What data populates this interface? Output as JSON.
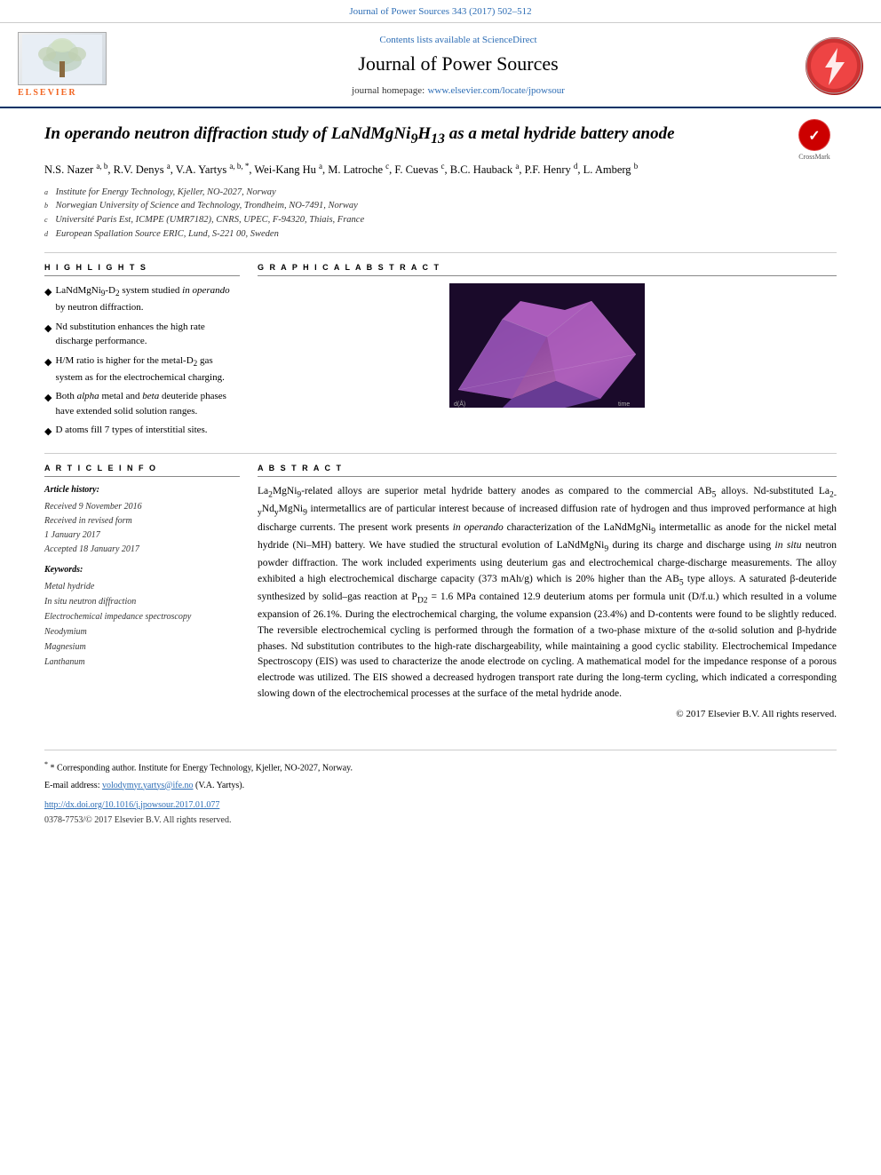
{
  "topBar": {
    "text": "Journal of Power Sources 343 (2017) 502–512"
  },
  "header": {
    "sciencedirect": "Contents lists available at ScienceDirect",
    "journalTitle": "Journal of Power Sources",
    "homepageLabel": "journal homepage:",
    "homepageUrl": "www.elsevier.com/locate/jpowsour",
    "elsevier": "ELSEVIER"
  },
  "article": {
    "titlePart1": "In operando",
    "titlePart2": " neutron diffraction study of LaNdMgNi",
    "titleSub1": "9",
    "titlePart3": "H",
    "titleSub2": "13",
    "titlePart4": " as a metal hydride battery anode",
    "authors": "N.S. Nazer a, b, R.V. Denys a, V.A. Yartys a, b, *, Wei-Kang Hu a, M. Latroche c, F. Cuevas c, B.C. Hauback a, P.F. Henry d, L. Amberg b",
    "affiliations": [
      {
        "sup": "a",
        "text": "Institute for Energy Technology, Kjeller, NO-2027, Norway"
      },
      {
        "sup": "b",
        "text": "Norwegian University of Science and Technology, Trondheim, NO-7491, Norway"
      },
      {
        "sup": "c",
        "text": "Université Paris Est, ICMPE (UMR7182), CNRS, UPEC, F-94320, Thiais, France"
      },
      {
        "sup": "d",
        "text": "European Spallation Source ERIC, Lund, S-221 00, Sweden"
      }
    ]
  },
  "highlights": {
    "sectionTitle": "H I G H L I G H T S",
    "items": [
      "LaNdMgNi9-D2 system studied in operando by neutron diffraction.",
      "Nd substitution enhances the high rate discharge performance.",
      "H/M ratio is higher for the metal-D2 gas system as for the electrochemical charging.",
      "Both alpha metal and beta deuteride phases have extended solid solution ranges.",
      "D atoms fill 7 types of interstitial sites."
    ]
  },
  "graphicalAbstract": {
    "sectionTitle": "G R A P H I C A L   A B S T R A C T"
  },
  "articleInfo": {
    "sectionTitle": "A R T I C L E   I N F O",
    "historyLabel": "Article history:",
    "received": "Received 9 November 2016",
    "receivedRevised": "Received in revised form",
    "revisedDate": "1 January 2017",
    "accepted": "Accepted 18 January 2017",
    "keywordsLabel": "Keywords:",
    "keywords": [
      "Metal hydride",
      "In situ neutron diffraction",
      "Electrochemical impedance spectroscopy",
      "Neodymium",
      "Magnesium",
      "Lanthanum"
    ]
  },
  "abstract": {
    "sectionTitle": "A B S T R A C T",
    "text": "La2MgNi9-related alloys are superior metal hydride battery anodes as compared to the commercial AB5 alloys. Nd-substituted La2-yNdyMgNi9 intermetallics are of particular interest because of increased diffusion rate of hydrogen and thus improved performance at high discharge currents. The present work presents in operando characterization of the LaNdMgNi9 intermetallic as anode for the nickel metal hydride (Ni–MH) battery. We have studied the structural evolution of LaNdMgNi9 during its charge and discharge using in situ neutron powder diffraction. The work included experiments using deuterium gas and electrochemical charge-discharge measurements. The alloy exhibited a high electrochemical discharge capacity (373 mAh/g) which is 20% higher than the AB5 type alloys. A saturated β-deuteride synthesized by solid–gas reaction at PD2 = 1.6 MPa contained 12.9 deuterium atoms per formula unit (D/f.u.) which resulted in a volume expansion of 26.1%. During the electrochemical charging, the volume expansion (23.4%) and D-contents were found to be slightly reduced. The reversible electrochemical cycling is performed through the formation of a two-phase mixture of the α-solid solution and β-hydride phases. Nd substitution contributes to the high-rate dischargeability, while maintaining a good cyclic stability. Electrochemical Impedance Spectroscopy (EIS) was used to characterize the anode electrode on cycling. A mathematical model for the impedance response of a porous electrode was utilized. The EIS showed a decreased hydrogen transport rate during the long-term cycling, which indicated a corresponding slowing down of the electrochemical processes at the surface of the metal hydride anode.",
    "copyright": "© 2017 Elsevier B.V. All rights reserved."
  },
  "footer": {
    "correspondingNote": "* Corresponding author. Institute for Energy Technology, Kjeller, NO-2027, Norway.",
    "emailLabel": "E-mail address:",
    "email": "volodymyr.yartys@ife.no",
    "emailSuffix": " (V.A. Yartys).",
    "doi": "http://dx.doi.org/10.1016/j.jpowsour.2017.01.077",
    "issn": "0378-7753/© 2017 Elsevier B.V. All rights reserved."
  }
}
